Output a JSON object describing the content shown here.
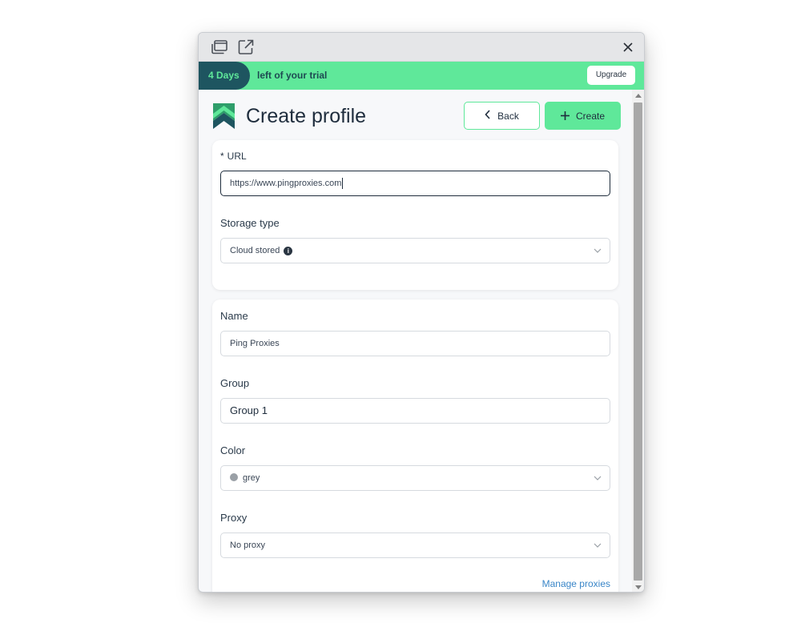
{
  "titlebar": {
    "window_icon": "window-icon",
    "external_icon": "external-link-icon",
    "close_icon": "close-icon"
  },
  "trial": {
    "days": "4 Days",
    "text": "left of your trial",
    "upgrade_label": "Upgrade"
  },
  "header": {
    "title": "Create profile",
    "back_label": "Back",
    "create_label": "Create"
  },
  "url_card": {
    "url_label": "URL",
    "url_required_mark": "*",
    "url_value": "https://www.pingproxies.com",
    "storage_label": "Storage type",
    "storage_value": "Cloud stored",
    "storage_info": "i"
  },
  "profile_card": {
    "name_label": "Name",
    "name_value": "Ping Proxies",
    "group_label": "Group",
    "group_value": "Group 1",
    "color_label": "Color",
    "color_value": "grey",
    "proxy_label": "Proxy",
    "proxy_value": "No proxy",
    "manage_proxies_label": "Manage proxies"
  },
  "colors": {
    "accent": "#5fe89a",
    "trial_badge": "#1e5560",
    "link": "#3a86c8",
    "grey_swatch": "#9aa0a6"
  }
}
